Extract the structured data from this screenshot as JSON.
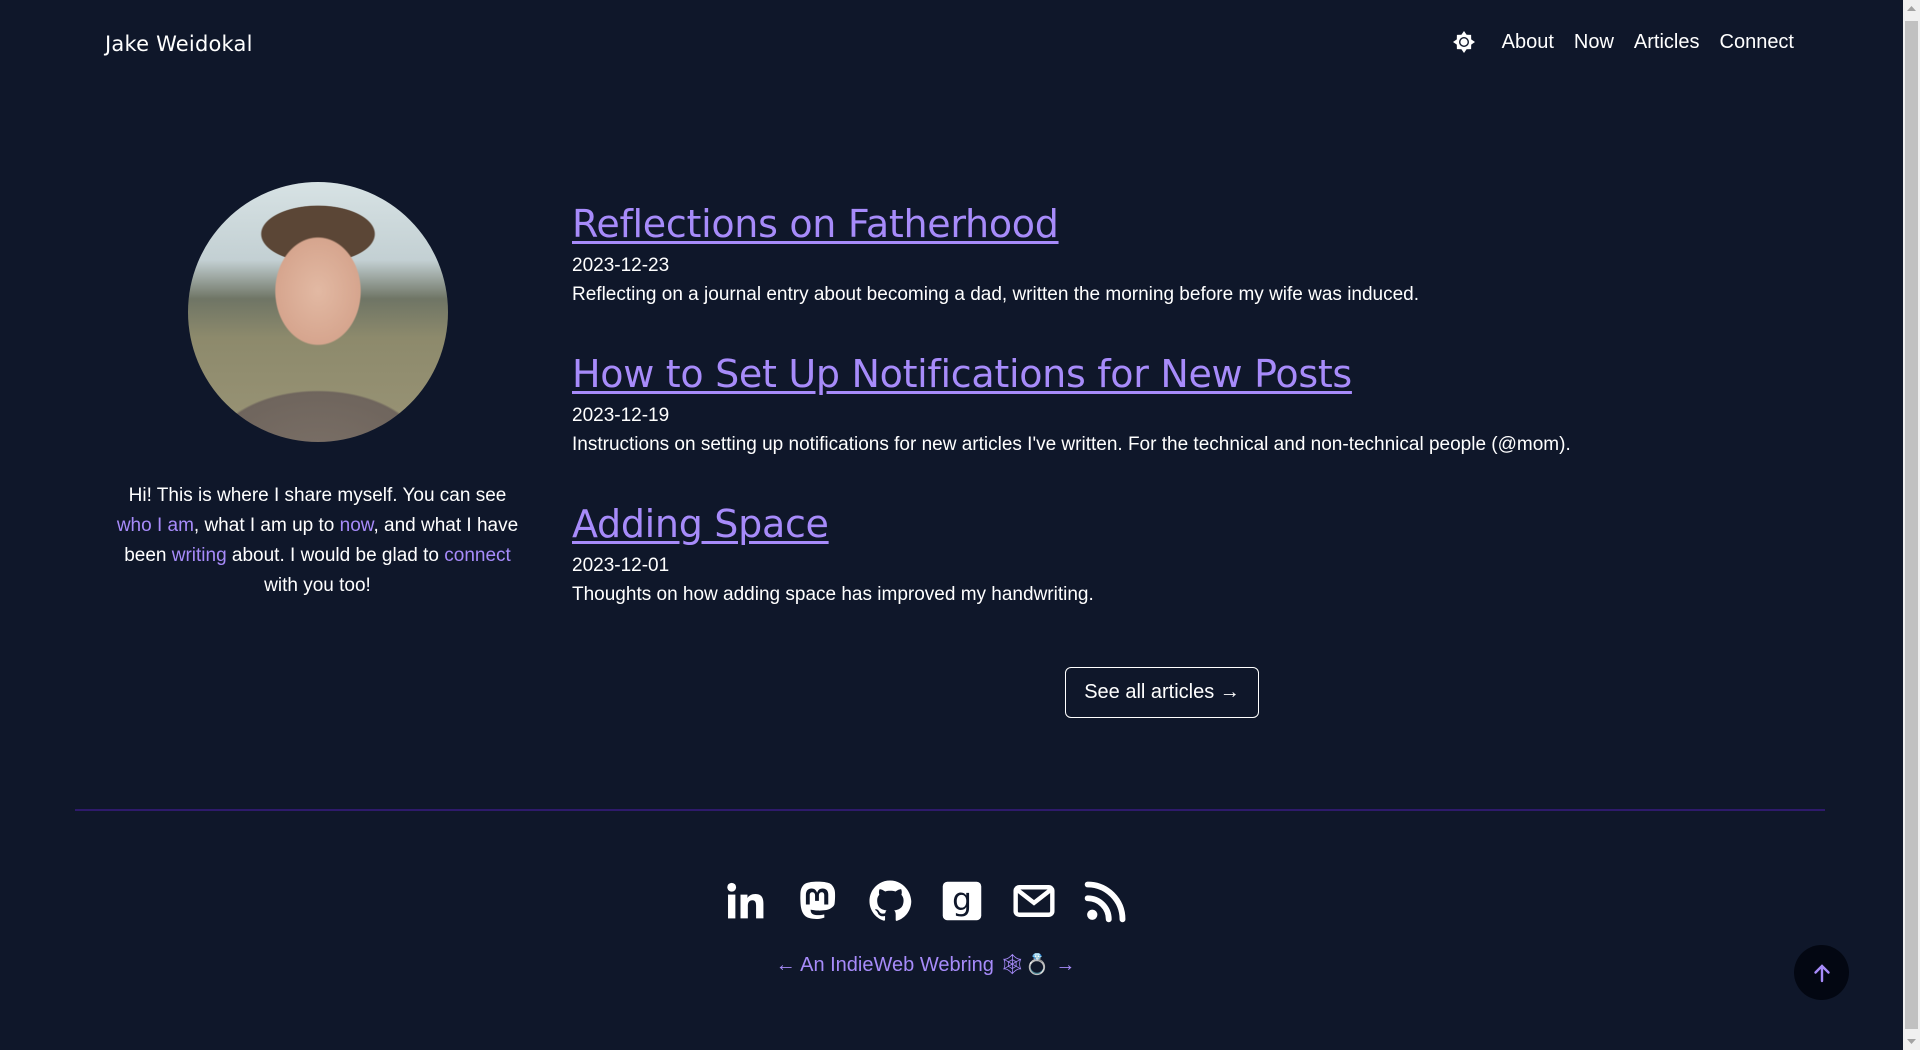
{
  "header": {
    "site_title": "Jake Weidokal",
    "theme_toggle_icon": "sun-icon",
    "nav": [
      {
        "label": "About"
      },
      {
        "label": "Now"
      },
      {
        "label": "Articles"
      },
      {
        "label": "Connect"
      }
    ]
  },
  "sidebar": {
    "avatar_alt": "Photo of Jake Weidokal",
    "bio": {
      "t1": "Hi! This is where I share myself. You can see ",
      "link1": "who I am",
      "t2": ", what I am up to ",
      "link2": "now",
      "t3": ", and what I have been ",
      "link3": "writing",
      "t4": " about. I would be glad to ",
      "link4": "connect",
      "t5": " with you too!"
    }
  },
  "articles": [
    {
      "title": "Reflections on Fatherhood",
      "date": "2023-12-23",
      "summary": "Reflecting on a journal entry about becoming a dad, written the morning before my wife was induced."
    },
    {
      "title": "How to Set Up Notifications for New Posts",
      "date": "2023-12-19",
      "summary": "Instructions on setting up notifications for new articles I've written. For the technical and non-technical people (@mom)."
    },
    {
      "title": "Adding Space",
      "date": "2023-12-01",
      "summary": "Thoughts on how adding space has improved my handwriting."
    }
  ],
  "see_all_label": "See all articles →",
  "footer": {
    "socials": [
      {
        "name": "linkedin",
        "icon": "linkedin-icon"
      },
      {
        "name": "mastodon",
        "icon": "mastodon-icon"
      },
      {
        "name": "github",
        "icon": "github-icon"
      },
      {
        "name": "goodreads",
        "icon": "goodreads-icon"
      },
      {
        "name": "email",
        "icon": "mail-icon"
      },
      {
        "name": "rss",
        "icon": "rss-icon"
      }
    ],
    "webring": {
      "prev": "←",
      "label": "An IndieWeb Webring 🕸💍",
      "next": "→"
    }
  },
  "colors": {
    "background": "#0f172a",
    "accent": "#a78bfa",
    "divider": "#2e1a6b",
    "to_top_bg": "#030712"
  }
}
